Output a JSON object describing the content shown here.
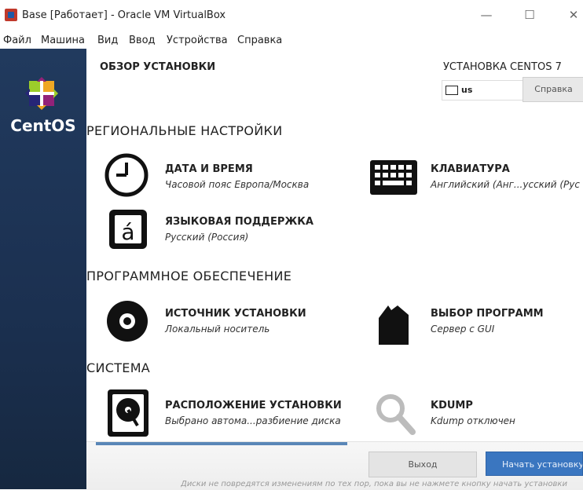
{
  "window": {
    "title": "Base [Работает] - Oracle VM VirtualBox",
    "minimize_symbol": "—",
    "maximize_symbol": "☐",
    "close_symbol": "✕"
  },
  "menubar": {
    "items": [
      "Файл",
      "Машина",
      "Вид",
      "Ввод",
      "Устройства",
      "Справка"
    ]
  },
  "sidebar": {
    "brand": "CentOS"
  },
  "header": {
    "title": "ОБЗОР УСТАНОВКИ",
    "product": "УСТАНОВКА CENTOS 7",
    "keyboard_layout": "us",
    "help_label": "Справка"
  },
  "sections": {
    "regional": "РЕГИОНАЛЬНЫЕ НАСТРОЙКИ",
    "software": "ПРОГРАММНОЕ ОБЕСПЕЧЕНИЕ",
    "system": "СИСТЕМА"
  },
  "spokes": {
    "datetime": {
      "title": "ДАТА И ВРЕМЯ",
      "subtitle": "Часовой пояс Европа/Москва",
      "icon": "clock-icon"
    },
    "keyboard": {
      "title": "КЛАВИАТУРА",
      "subtitle": "Английский (Анг...усский (Рус",
      "icon": "keyboard-icon"
    },
    "language": {
      "title": "ЯЗЫКОВАЯ ПОДДЕРЖКА",
      "subtitle": "Русский (Россия)",
      "icon": "language-icon"
    },
    "source": {
      "title": "ИСТОЧНИК УСТАНОВКИ",
      "subtitle": "Локальный носитель",
      "icon": "disc-icon"
    },
    "software": {
      "title": "ВЫБОР ПРОГРАММ",
      "subtitle": "Сервер с GUI",
      "icon": "package-icon"
    },
    "destination": {
      "title": "РАСПОЛОЖЕНИЕ УСТАНОВКИ",
      "subtitle": "Выбрано автома...разбиение диска",
      "icon": "harddisk-icon"
    },
    "kdump": {
      "title": "KDUMP",
      "subtitle": "Kdump отключен",
      "icon": "search-icon"
    }
  },
  "footer": {
    "exit_label": "Выход",
    "start_label": "Начать установку",
    "note": "Диски не повредятся изменениям по тех пор, пока вы не нажмете кнопку начать установки"
  }
}
